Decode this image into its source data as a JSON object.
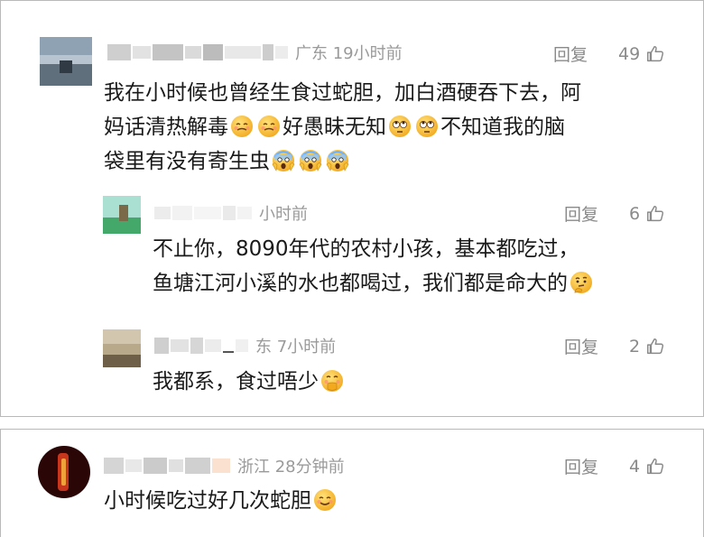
{
  "comments": [
    {
      "meta": "广东 19小时前",
      "reply": "回复",
      "likes": "49",
      "lines": [
        "我在小时候也曾经生食过蛇胆，加白酒硬吞下去，阿",
        "妈话清热解毒",
        "好愚昧无知",
        "不知道我的脑",
        "袋里有没有寄生虫"
      ],
      "replies": [
        {
          "meta": "小时前",
          "reply": "回复",
          "likes": "6",
          "lines": [
            "不止你，8090年代的农村小孩，基本都吃过，",
            "鱼塘江河小溪的水也都喝过，我们都是命大的"
          ]
        },
        {
          "meta": "东 7小时前",
          "reply": "回复",
          "likes": "2",
          "lines": [
            "我都系，食过唔少"
          ]
        }
      ]
    },
    {
      "meta": "浙江 28分钟前",
      "reply": "回复",
      "likes": "4",
      "lines": [
        "小时候吃过好几次蛇胆"
      ]
    }
  ],
  "icons": {
    "thumb": "thumbs-up-icon",
    "emoji_blush_sweat": "face-with-sweat-emoji",
    "emoji_eyeroll": "face-with-rolling-eyes-emoji",
    "emoji_scream": "face-screaming-in-fear-emoji",
    "emoji_thinking": "thinking-face-emoji",
    "emoji_shush": "face-with-hand-over-mouth-emoji",
    "emoji_smile": "smiling-face-emoji"
  },
  "colors": {
    "meta": "#9a9a9a",
    "text": "#1a1a1a",
    "border": "#b9b9b9",
    "emoji": "#f7c43a"
  }
}
